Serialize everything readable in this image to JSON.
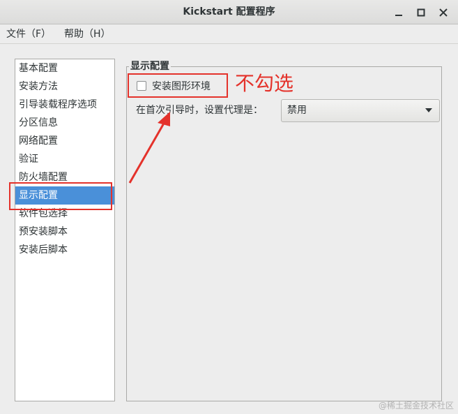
{
  "window": {
    "title": "Kickstart 配置程序",
    "minimize_glyph": "–",
    "maximize_glyph": "□",
    "close_glyph": "✕"
  },
  "menubar": {
    "items": [
      "文件（F）",
      "帮助（H）"
    ]
  },
  "sidebar": {
    "items": [
      "基本配置",
      "安装方法",
      "引导装载程序选项",
      "分区信息",
      "网络配置",
      "验证",
      "防火墙配置",
      "显示配置",
      "软件包选择",
      "预安装脚本",
      "安装后脚本"
    ],
    "selected": "显示配置"
  },
  "display_panel": {
    "title": "显示配置",
    "install_gui_checkbox_label": "安装图形环境",
    "install_gui_checked": false,
    "proxy_label": "在首次引导时，设置代理是：",
    "proxy_value": "禁用"
  },
  "annotation": {
    "text": "不勾选",
    "color": "#e4322b"
  },
  "watermark": "@稀土掘金技术社区",
  "colors": {
    "selection": "#4a90d9",
    "background": "#ededed"
  }
}
